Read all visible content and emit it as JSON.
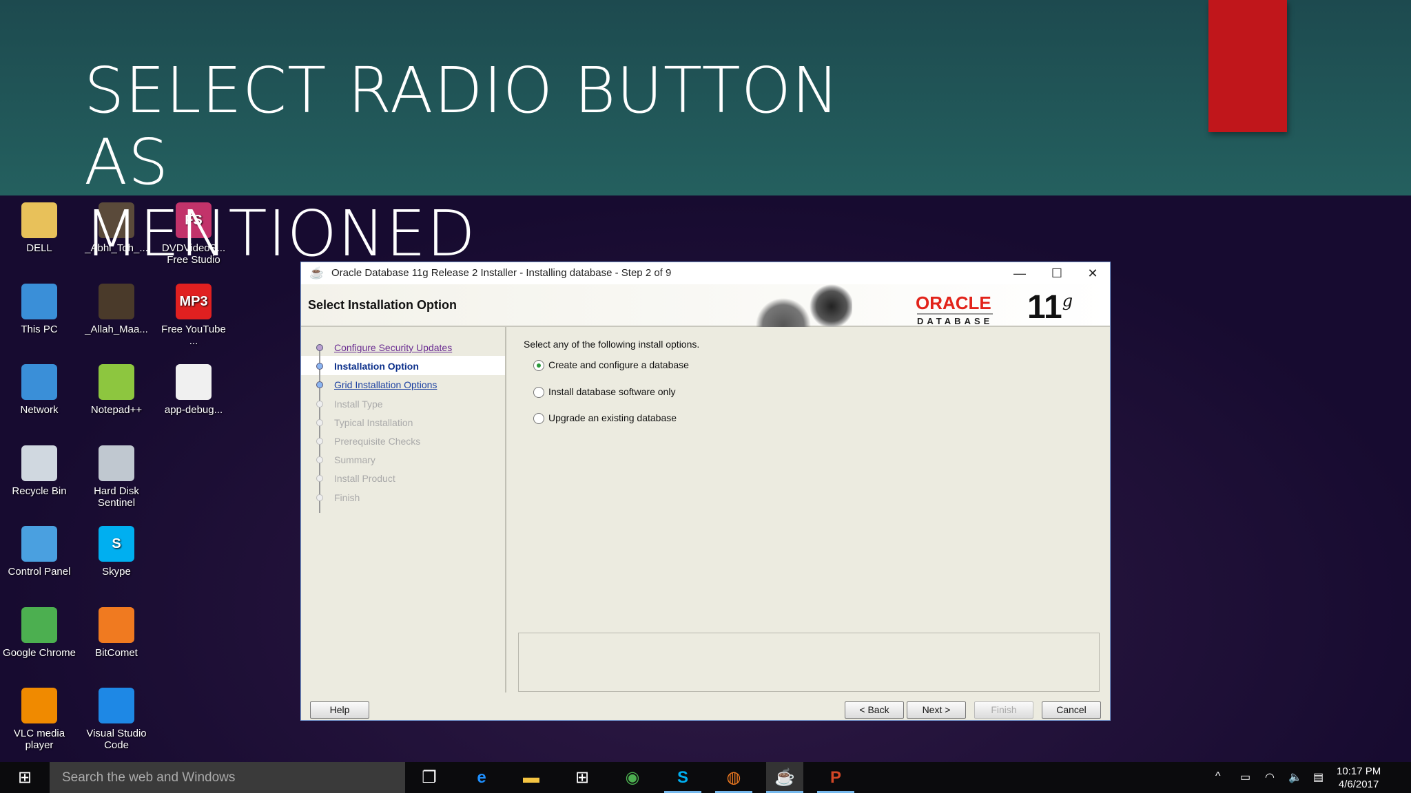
{
  "slide": {
    "title_line1": "SELECT RADIO BUTTON AS",
    "title_line2": "MENTIONED"
  },
  "desktop_icons": [
    {
      "label": "DELL",
      "color": "#e8c15a"
    },
    {
      "label": "_Abhi_Toh_...",
      "color": "#5a4a3a"
    },
    {
      "label": "DVDVideoS... Free Studio",
      "color": "#c2336a",
      "glyph": "FS"
    },
    {
      "label": "This PC",
      "color": "#3a8fd8"
    },
    {
      "label": "_Allah_Maa...",
      "color": "#4a3a2a"
    },
    {
      "label": "Free YouTube ...",
      "color": "#e02020",
      "glyph": "MP3"
    },
    {
      "label": "Network",
      "color": "#3a8fd8"
    },
    {
      "label": "Notepad++",
      "color": "#8dc63f"
    },
    {
      "label": "app-debug...",
      "color": "#f0f0f0"
    },
    {
      "label": "Recycle Bin",
      "color": "#d0d8e0"
    },
    {
      "label": "Hard Disk Sentinel",
      "color": "#c0c8d0"
    },
    {
      "label": "Control Panel",
      "color": "#4aa0e0"
    },
    {
      "label": "Skype",
      "color": "#00aff0",
      "glyph": "S"
    },
    {
      "label": "Google Chrome",
      "color": "#4caf50"
    },
    {
      "label": "BitComet",
      "color": "#f07a20"
    },
    {
      "label": "VLC media player",
      "color": "#f08a00"
    },
    {
      "label": "Visual Studio Code",
      "color": "#1e88e5"
    }
  ],
  "dialog": {
    "title": "Oracle Database 11g Release 2 Installer - Installing database - Step 2 of 9",
    "header": "Select Installation Option",
    "brand": {
      "oracle": "ORACLE",
      "database": "DATABASE",
      "version": "11",
      "version_sup": "g"
    },
    "steps": [
      {
        "label": "Configure Security Updates",
        "state": "done"
      },
      {
        "label": "Installation Option",
        "state": "current"
      },
      {
        "label": "Grid Installation Options",
        "state": "link"
      },
      {
        "label": "Install Type",
        "state": "pending"
      },
      {
        "label": "Typical Installation",
        "state": "pending"
      },
      {
        "label": "Prerequisite Checks",
        "state": "pending"
      },
      {
        "label": "Summary",
        "state": "pending"
      },
      {
        "label": "Install Product",
        "state": "pending"
      },
      {
        "label": "Finish",
        "state": "pending"
      }
    ],
    "instruction": "Select any of the following install options.",
    "options": [
      {
        "label": "Create and configure a database",
        "selected": true
      },
      {
        "label": "Install database software only",
        "selected": false
      },
      {
        "label": "Upgrade an existing database",
        "selected": false
      }
    ],
    "buttons": {
      "help": "Help",
      "back": "< Back",
      "next": "Next >",
      "finish": "Finish",
      "cancel": "Cancel"
    }
  },
  "taskbar": {
    "search_placeholder": "Search the web and Windows",
    "time": "10:17 PM",
    "date": "4/6/2017"
  }
}
